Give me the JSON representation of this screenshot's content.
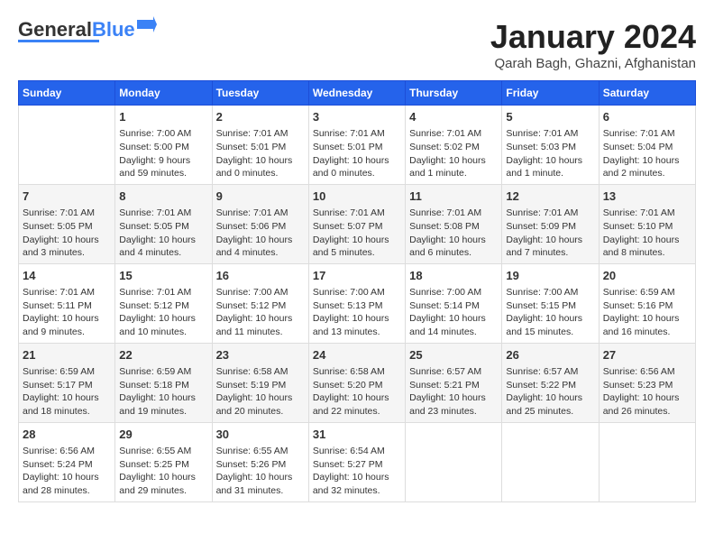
{
  "header": {
    "logo_general": "General",
    "logo_blue": "Blue",
    "month_year": "January 2024",
    "location": "Qarah Bagh, Ghazni, Afghanistan"
  },
  "days_of_week": [
    "Sunday",
    "Monday",
    "Tuesday",
    "Wednesday",
    "Thursday",
    "Friday",
    "Saturday"
  ],
  "weeks": [
    [
      {
        "day": "",
        "data": ""
      },
      {
        "day": "1",
        "data": "Sunrise: 7:00 AM\nSunset: 5:00 PM\nDaylight: 9 hours\nand 59 minutes."
      },
      {
        "day": "2",
        "data": "Sunrise: 7:01 AM\nSunset: 5:01 PM\nDaylight: 10 hours\nand 0 minutes."
      },
      {
        "day": "3",
        "data": "Sunrise: 7:01 AM\nSunset: 5:01 PM\nDaylight: 10 hours\nand 0 minutes."
      },
      {
        "day": "4",
        "data": "Sunrise: 7:01 AM\nSunset: 5:02 PM\nDaylight: 10 hours\nand 1 minute."
      },
      {
        "day": "5",
        "data": "Sunrise: 7:01 AM\nSunset: 5:03 PM\nDaylight: 10 hours\nand 1 minute."
      },
      {
        "day": "6",
        "data": "Sunrise: 7:01 AM\nSunset: 5:04 PM\nDaylight: 10 hours\nand 2 minutes."
      }
    ],
    [
      {
        "day": "7",
        "data": "Sunrise: 7:01 AM\nSunset: 5:05 PM\nDaylight: 10 hours\nand 3 minutes."
      },
      {
        "day": "8",
        "data": "Sunrise: 7:01 AM\nSunset: 5:05 PM\nDaylight: 10 hours\nand 4 minutes."
      },
      {
        "day": "9",
        "data": "Sunrise: 7:01 AM\nSunset: 5:06 PM\nDaylight: 10 hours\nand 4 minutes."
      },
      {
        "day": "10",
        "data": "Sunrise: 7:01 AM\nSunset: 5:07 PM\nDaylight: 10 hours\nand 5 minutes."
      },
      {
        "day": "11",
        "data": "Sunrise: 7:01 AM\nSunset: 5:08 PM\nDaylight: 10 hours\nand 6 minutes."
      },
      {
        "day": "12",
        "data": "Sunrise: 7:01 AM\nSunset: 5:09 PM\nDaylight: 10 hours\nand 7 minutes."
      },
      {
        "day": "13",
        "data": "Sunrise: 7:01 AM\nSunset: 5:10 PM\nDaylight: 10 hours\nand 8 minutes."
      }
    ],
    [
      {
        "day": "14",
        "data": "Sunrise: 7:01 AM\nSunset: 5:11 PM\nDaylight: 10 hours\nand 9 minutes."
      },
      {
        "day": "15",
        "data": "Sunrise: 7:01 AM\nSunset: 5:12 PM\nDaylight: 10 hours\nand 10 minutes."
      },
      {
        "day": "16",
        "data": "Sunrise: 7:00 AM\nSunset: 5:12 PM\nDaylight: 10 hours\nand 11 minutes."
      },
      {
        "day": "17",
        "data": "Sunrise: 7:00 AM\nSunset: 5:13 PM\nDaylight: 10 hours\nand 13 minutes."
      },
      {
        "day": "18",
        "data": "Sunrise: 7:00 AM\nSunset: 5:14 PM\nDaylight: 10 hours\nand 14 minutes."
      },
      {
        "day": "19",
        "data": "Sunrise: 7:00 AM\nSunset: 5:15 PM\nDaylight: 10 hours\nand 15 minutes."
      },
      {
        "day": "20",
        "data": "Sunrise: 6:59 AM\nSunset: 5:16 PM\nDaylight: 10 hours\nand 16 minutes."
      }
    ],
    [
      {
        "day": "21",
        "data": "Sunrise: 6:59 AM\nSunset: 5:17 PM\nDaylight: 10 hours\nand 18 minutes."
      },
      {
        "day": "22",
        "data": "Sunrise: 6:59 AM\nSunset: 5:18 PM\nDaylight: 10 hours\nand 19 minutes."
      },
      {
        "day": "23",
        "data": "Sunrise: 6:58 AM\nSunset: 5:19 PM\nDaylight: 10 hours\nand 20 minutes."
      },
      {
        "day": "24",
        "data": "Sunrise: 6:58 AM\nSunset: 5:20 PM\nDaylight: 10 hours\nand 22 minutes."
      },
      {
        "day": "25",
        "data": "Sunrise: 6:57 AM\nSunset: 5:21 PM\nDaylight: 10 hours\nand 23 minutes."
      },
      {
        "day": "26",
        "data": "Sunrise: 6:57 AM\nSunset: 5:22 PM\nDaylight: 10 hours\nand 25 minutes."
      },
      {
        "day": "27",
        "data": "Sunrise: 6:56 AM\nSunset: 5:23 PM\nDaylight: 10 hours\nand 26 minutes."
      }
    ],
    [
      {
        "day": "28",
        "data": "Sunrise: 6:56 AM\nSunset: 5:24 PM\nDaylight: 10 hours\nand 28 minutes."
      },
      {
        "day": "29",
        "data": "Sunrise: 6:55 AM\nSunset: 5:25 PM\nDaylight: 10 hours\nand 29 minutes."
      },
      {
        "day": "30",
        "data": "Sunrise: 6:55 AM\nSunset: 5:26 PM\nDaylight: 10 hours\nand 31 minutes."
      },
      {
        "day": "31",
        "data": "Sunrise: 6:54 AM\nSunset: 5:27 PM\nDaylight: 10 hours\nand 32 minutes."
      },
      {
        "day": "",
        "data": ""
      },
      {
        "day": "",
        "data": ""
      },
      {
        "day": "",
        "data": ""
      }
    ]
  ]
}
